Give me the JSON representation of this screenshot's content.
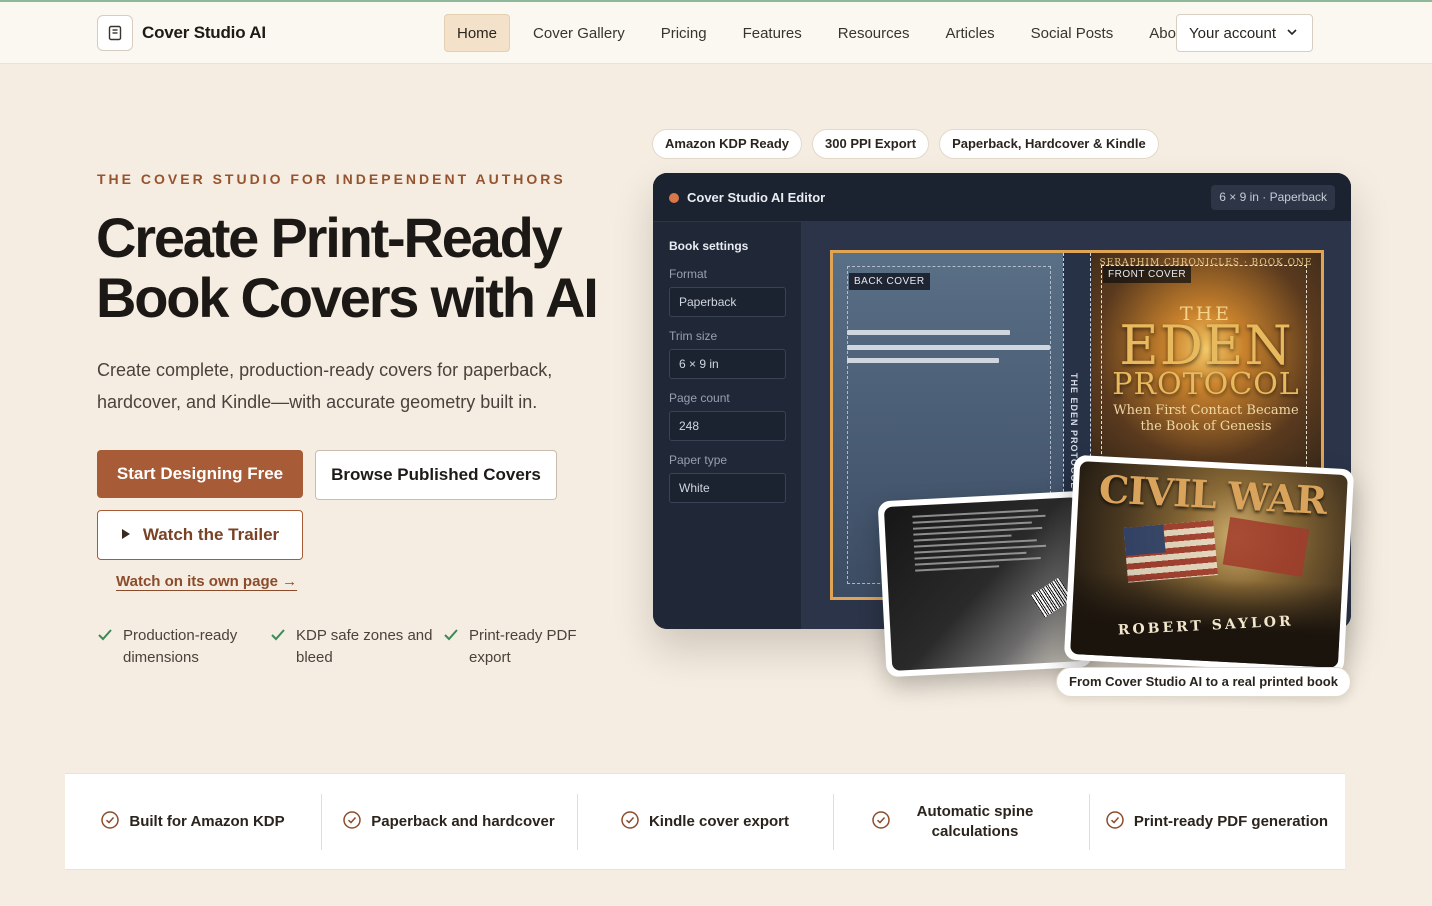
{
  "nav": {
    "brand": "Cover Studio AI",
    "links": [
      "Home",
      "Cover Gallery",
      "Pricing",
      "Features",
      "Resources",
      "Articles",
      "Social Posts",
      "About"
    ],
    "active": "Home",
    "account_label": "Your account"
  },
  "hero": {
    "eyebrow": "THE COVER STUDIO FOR INDEPENDENT AUTHORS",
    "title": "Create Print-Ready Book Covers with AI",
    "subtitle": "Create complete, production-ready covers for paperback, hardcover, and Kindle—with accurate geometry built in.",
    "primary_cta": "Start Designing Free",
    "secondary_cta": "Browse Published Covers",
    "trailer_cta": "Watch the Trailer",
    "trailer_link": "Watch on its own page →",
    "features": [
      "Production-ready dimensions",
      "KDP safe zones and bleed",
      "Print-ready PDF export"
    ]
  },
  "pills": [
    "Amazon KDP Ready",
    "300 PPI Export",
    "Paperback, Hardcover & Kindle"
  ],
  "editor": {
    "title": "Cover Studio AI Editor",
    "badge": "6 × 9 in · Paperback",
    "settings_title": "Book settings",
    "fields": [
      {
        "label": "Format",
        "value": "Paperback"
      },
      {
        "label": "Trim size",
        "value": "6 × 9 in"
      },
      {
        "label": "Page count",
        "value": "248"
      },
      {
        "label": "Paper type",
        "value": "White"
      }
    ],
    "back_cover_tag": "BACK COVER",
    "front_cover_tag": "FRONT COVER",
    "spine_text": "THE EDEN PROTOCOL",
    "front": {
      "series": "SERAPHIM CHRONICLES · BOOK ONE",
      "the": "THE",
      "eden": "EDEN",
      "protocol": "PROTOCOL",
      "subtitle": "When First Contact Became the Book of Genesis"
    }
  },
  "printed": {
    "title": "CIVIL WAR",
    "author": "ROBERT SAYLOR",
    "caption": "From Cover Studio AI to a real printed book"
  },
  "strip": [
    "Built for Amazon KDP",
    "Paperback and hardcover",
    "Kindle cover export",
    "Automatic spine calculations",
    "Print-ready PDF generation"
  ],
  "colors": {
    "accent": "#a75b36",
    "background": "#f5ede1",
    "editor_bg": "#1d2433",
    "spread_border": "#e0a455"
  }
}
